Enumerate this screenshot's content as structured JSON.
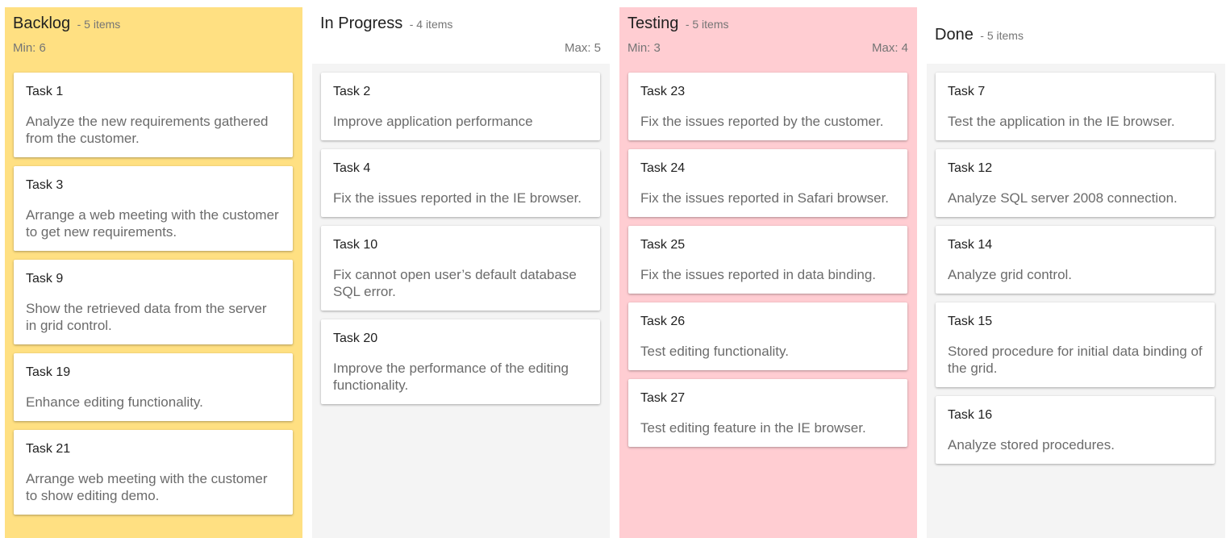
{
  "colors": {
    "backlog_bg": "#FFE082",
    "in_progress_bg": "#F4F4F4",
    "testing_bg": "#FFCDD2",
    "done_bg": "#F4F4F4",
    "card_bg": "#FFFFFF"
  },
  "columns": [
    {
      "title": "Backlog",
      "count": "- 5 items",
      "min": "Min: 6",
      "max": "",
      "cards": [
        {
          "title": "Task 1",
          "desc": "Analyze the new requirements gathered from the customer."
        },
        {
          "title": "Task 3",
          "desc": "Arrange a web meeting with the customer to get new requirements."
        },
        {
          "title": "Task 9",
          "desc": "Show the retrieved data from the server in grid control."
        },
        {
          "title": "Task 19",
          "desc": "Enhance editing functionality."
        },
        {
          "title": "Task 21",
          "desc": "Arrange web meeting with the customer to show editing demo."
        }
      ]
    },
    {
      "title": "In Progress",
      "count": "- 4 items",
      "min": "",
      "max": "Max: 5",
      "cards": [
        {
          "title": "Task 2",
          "desc": "Improve application performance"
        },
        {
          "title": "Task 4",
          "desc": "Fix the issues reported in the IE browser."
        },
        {
          "title": "Task 10",
          "desc": "Fix cannot open user’s default database SQL error."
        },
        {
          "title": "Task 20",
          "desc": "Improve the performance of the editing functionality."
        }
      ]
    },
    {
      "title": "Testing",
      "count": "- 5 items",
      "min": "Min: 3",
      "max": "Max: 4",
      "cards": [
        {
          "title": "Task 23",
          "desc": "Fix the issues reported by the customer."
        },
        {
          "title": "Task 24",
          "desc": "Fix the issues reported in Safari browser."
        },
        {
          "title": "Task 25",
          "desc": "Fix the issues reported in data binding."
        },
        {
          "title": "Task 26",
          "desc": "Test editing functionality."
        },
        {
          "title": "Task 27",
          "desc": "Test editing feature in the IE browser."
        }
      ]
    },
    {
      "title": "Done",
      "count": "- 5 items",
      "min": "",
      "max": "",
      "cards": [
        {
          "title": "Task 7",
          "desc": "Test the application in the IE browser."
        },
        {
          "title": "Task 12",
          "desc": "Analyze SQL server 2008 connection."
        },
        {
          "title": "Task 14",
          "desc": "Analyze grid control."
        },
        {
          "title": "Task 15",
          "desc": "Stored procedure for initial data binding of the grid."
        },
        {
          "title": "Task 16",
          "desc": "Analyze stored procedures."
        }
      ]
    }
  ]
}
